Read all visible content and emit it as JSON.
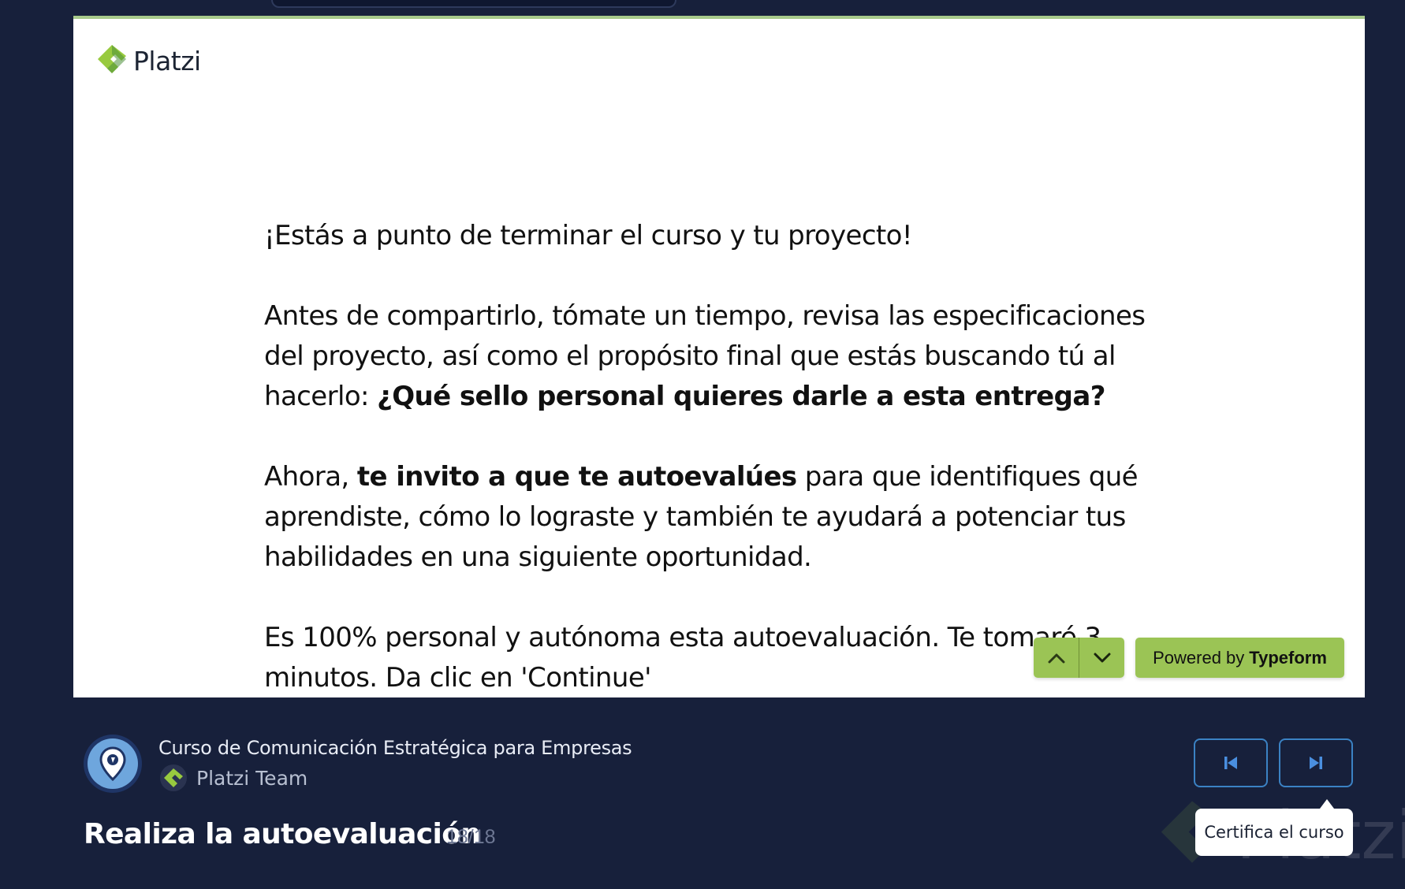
{
  "form": {
    "logo_text": "Platzi",
    "greeting": "¡Estás a punto de terminar el curso y tu proyecto!",
    "paragraph2_text": "Antes de compartirlo, tómate un tiempo, revisa las especificaciones del proyecto, así como el propósito final que estás buscando tú al hacerlo: ",
    "paragraph2_bold": "¿Qué sello personal quieres darle a esta entrega?",
    "paragraph3_start": "Ahora, ",
    "paragraph3_bold": "te invito a que te autoevalúes",
    "paragraph3_end": " para que identifiques qué aprendiste, cómo lo lograste y también te ayudará a potenciar tus habilidades en una siguiente oportunidad.",
    "paragraph4": "Es 100% personal y autónoma esta autoevaluación. Te tomaré 3 minutos. Da clic en 'Continue'",
    "powered_prefix": "Powered by",
    "powered_brand": "Typeform",
    "nav_up_icon": "chevron-up-icon",
    "nav_down_icon": "chevron-down-icon",
    "accent_color": "#9bc455"
  },
  "course": {
    "title": "Curso de Comunicación Estratégica para Empresas",
    "team": "Platzi Team",
    "avatar_icon": "location-pin-icon"
  },
  "lesson": {
    "title": "Realiza la autoevaluación",
    "counter": "18/18"
  },
  "controls": {
    "prev_icon": "skip-previous-icon",
    "next_icon": "skip-next-icon",
    "tooltip": "Certifica el curso",
    "border_color": "#3b82c4"
  },
  "watermark": {
    "text": "Platzi"
  },
  "colors": {
    "background": "#17203b",
    "brand_green": "#98ca3f"
  }
}
